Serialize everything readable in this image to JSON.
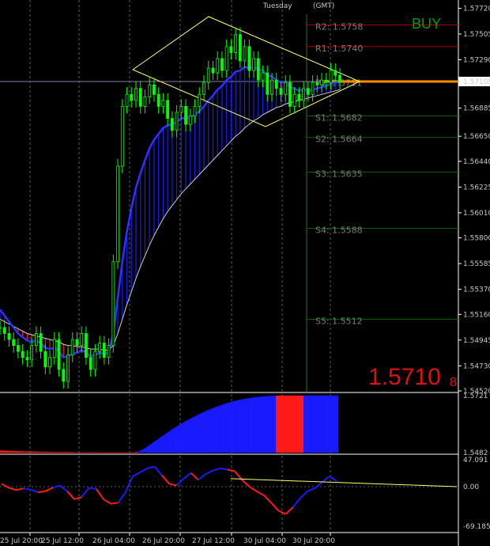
{
  "header": {
    "day": "Tuesday",
    "tz": "(GMT)"
  },
  "signal": "BUY",
  "bid": {
    "main": "1.5710",
    "small": "8"
  },
  "colors": {
    "candle": "#00ff00",
    "bull": "#1a1aff",
    "bear": "#ff1a1a",
    "level": "#006400",
    "resistance": "#b40000",
    "pivot_line": "#ff8c00",
    "channel": "#ffff66",
    "osc_trend": "#ffff66"
  },
  "chart_data": [
    {
      "type": "line",
      "title": "",
      "price_axis": [
        "1.57720",
        "1.57505",
        "1.57290",
        "1.57108",
        "1.56885",
        "1.56650",
        "1.56440",
        "1.56225",
        "1.56010",
        "1.55800",
        "1.55585",
        "1.55370",
        "1.55160",
        "1.54945",
        "1.54730",
        "1.54520"
      ],
      "ylim": [
        1.5452,
        1.5775
      ],
      "current_price": 1.57108,
      "pivot_levels": [
        {
          "name": "R2",
          "value": 1.5758,
          "label": "R2: 1.5758"
        },
        {
          "name": "R1",
          "value": 1.574,
          "label": "R1: 1.5740"
        },
        {
          "name": "PV",
          "value": 1.5711,
          "label": "PV: 1.5711"
        },
        {
          "name": "S1",
          "value": 1.5682,
          "label": "S1: 1.5682"
        },
        {
          "name": "S2",
          "value": 1.5664,
          "label": "S2: 1.5664"
        },
        {
          "name": "S3",
          "value": 1.5635,
          "label": "S3: 1.5635"
        },
        {
          "name": "S4",
          "value": 1.5588,
          "label": "S4: 1.5588"
        },
        {
          "name": "S5",
          "value": 1.5512,
          "label": "S5: 1.5512"
        }
      ],
      "candles_close": [
        1.5505,
        1.55,
        1.5495,
        1.549,
        1.5485,
        1.548,
        1.5478,
        1.549,
        1.55,
        1.5485,
        1.5472,
        1.548,
        1.5495,
        1.547,
        1.546,
        1.5482,
        1.5495,
        1.549,
        1.55,
        1.548,
        1.547,
        1.5485,
        1.5492,
        1.548,
        1.549,
        1.556,
        1.564,
        1.569,
        1.57,
        1.5695,
        1.5705,
        1.569,
        1.5698,
        1.5708,
        1.57,
        1.569,
        1.5695,
        1.568,
        1.567,
        1.5685,
        1.569,
        1.5675,
        1.5682,
        1.569,
        1.57,
        1.571,
        1.5722,
        1.5718,
        1.573,
        1.572,
        1.574,
        1.5735,
        1.575,
        1.5728,
        1.574,
        1.572,
        1.573,
        1.5712,
        1.5718,
        1.57,
        1.5712,
        1.5705,
        1.57,
        1.571,
        1.569,
        1.57,
        1.5695,
        1.5705,
        1.57,
        1.571,
        1.5708,
        1.5712,
        1.571,
        1.572,
        1.5716,
        1.571
      ],
      "ma_fast": [
        1.552,
        1.5515,
        1.551,
        1.5505,
        1.55,
        1.5497,
        1.5494,
        1.5493,
        1.5494,
        1.5492,
        1.5488,
        1.5487,
        1.5488,
        1.5485,
        1.548,
        1.5481,
        1.5483,
        1.5484,
        1.5486,
        1.5484,
        1.5481,
        1.5482,
        1.5484,
        1.5483,
        1.5484,
        1.55,
        1.553,
        1.556,
        1.5585,
        1.5605,
        1.5622,
        1.5634,
        1.5645,
        1.5655,
        1.5662,
        1.5667,
        1.5672,
        1.5674,
        1.5675,
        1.5677,
        1.568,
        1.568,
        1.5681,
        1.5683,
        1.5686,
        1.569,
        1.5695,
        1.5699,
        1.5704,
        1.5707,
        1.5712,
        1.5715,
        1.5719,
        1.572,
        1.5723,
        1.5722,
        1.5723,
        1.5721,
        1.572,
        1.5716,
        1.5715,
        1.5712,
        1.571,
        1.571,
        1.5706,
        1.5705,
        1.5703,
        1.5704,
        1.5703,
        1.5704,
        1.5705,
        1.5706,
        1.5707,
        1.5709,
        1.571,
        1.571
      ],
      "ma_slow": [
        1.5512,
        1.551,
        1.5508,
        1.5506,
        1.5504,
        1.5502,
        1.55,
        1.5499,
        1.5498,
        1.5497,
        1.5496,
        1.5495,
        1.5494,
        1.5493,
        1.5491,
        1.549,
        1.549,
        1.5489,
        1.5489,
        1.5488,
        1.5487,
        1.5487,
        1.5487,
        1.5486,
        1.5486,
        1.549,
        1.55,
        1.5512,
        1.5524,
        1.5535,
        1.5546,
        1.5556,
        1.5565,
        1.5574,
        1.5582,
        1.5589,
        1.5596,
        1.5602,
        1.5607,
        1.5612,
        1.5617,
        1.5621,
        1.5625,
        1.5629,
        1.5633,
        1.5637,
        1.5641,
        1.5645,
        1.5649,
        1.5653,
        1.5657,
        1.5661,
        1.5665,
        1.5668,
        1.5672,
        1.5675,
        1.5678,
        1.568,
        1.5683,
        1.5685,
        1.5687,
        1.5689,
        1.569,
        1.5692,
        1.5693,
        1.5694,
        1.5695,
        1.5696,
        1.5697,
        1.5698,
        1.5699,
        1.57,
        1.5701,
        1.5702,
        1.5703,
        1.5704
      ]
    },
    {
      "type": "area",
      "title": "",
      "axis_labels": [
        "1.5721",
        "1.5482"
      ],
      "ylim": [
        1.5482,
        1.5721
      ],
      "values": [
        1.549,
        1.5489,
        1.5488,
        1.5487,
        1.5486,
        1.5486,
        1.5485,
        1.5485,
        1.5484,
        1.5484,
        1.5484,
        1.5483,
        1.5483,
        1.5483,
        1.5483,
        1.5482,
        1.5482,
        1.5482,
        1.5482,
        1.5482,
        1.5485,
        1.55,
        1.552,
        1.554,
        1.556,
        1.558,
        1.5598,
        1.5615,
        1.563,
        1.5645,
        1.5658,
        1.567,
        1.568,
        1.569,
        1.5698,
        1.5705,
        1.571,
        1.5714,
        1.5717,
        1.5719,
        1.572,
        1.5721,
        1.5721,
        1.5721,
        1.5721,
        1.5721,
        1.5721,
        1.5721,
        1.5721,
        1.5721
      ],
      "direction": [
        "down",
        "down",
        "down",
        "down",
        "down",
        "down",
        "down",
        "down",
        "down",
        "down",
        "down",
        "down",
        "down",
        "down",
        "down",
        "down",
        "down",
        "down",
        "down",
        "down",
        "up",
        "up",
        "up",
        "up",
        "up",
        "up",
        "up",
        "up",
        "up",
        "up",
        "up",
        "up",
        "up",
        "up",
        "up",
        "up",
        "up",
        "up",
        "up",
        "up",
        "down",
        "down",
        "down",
        "down",
        "up",
        "up",
        "up",
        "up",
        "up",
        "up"
      ]
    },
    {
      "type": "line",
      "title": "",
      "axis_labels": [
        "47.091",
        "0.00",
        "-69.1859"
      ],
      "ylim": [
        -69.1859,
        47.091
      ],
      "values": [
        5,
        -2,
        -6,
        -3,
        -5,
        -10,
        -8,
        -2,
        2,
        -8,
        -22,
        -18,
        -2,
        -4,
        -22,
        -30,
        -28,
        -10,
        18,
        25,
        32,
        35,
        20,
        5,
        2,
        14,
        24,
        12,
        22,
        28,
        32,
        30,
        27,
        12,
        0,
        -8,
        -15,
        -28,
        -42,
        -48,
        -36,
        -20,
        -8,
        -3,
        8,
        18,
        10
      ],
      "direction": [
        "down",
        "down",
        "down",
        "up",
        "up",
        "down",
        "down",
        "up",
        "up",
        "down",
        "down",
        "up",
        "up",
        "down",
        "down",
        "down",
        "up",
        "up",
        "up",
        "up",
        "up",
        "up",
        "down",
        "down",
        "up",
        "up",
        "down",
        "up",
        "up",
        "up",
        "up",
        "down",
        "down",
        "down",
        "down",
        "down",
        "down",
        "down",
        "down",
        "down",
        "up",
        "up",
        "up",
        "up",
        "up",
        "up",
        "down"
      ]
    }
  ],
  "time_axis": [
    "25 Jul 20:00",
    "25 Jul 12:00",
    "26 Jul 04:00",
    "26 Jul 20:00",
    "27 Jul 12:00",
    "30 Jul 04:00",
    "30 Jul 20:00"
  ]
}
